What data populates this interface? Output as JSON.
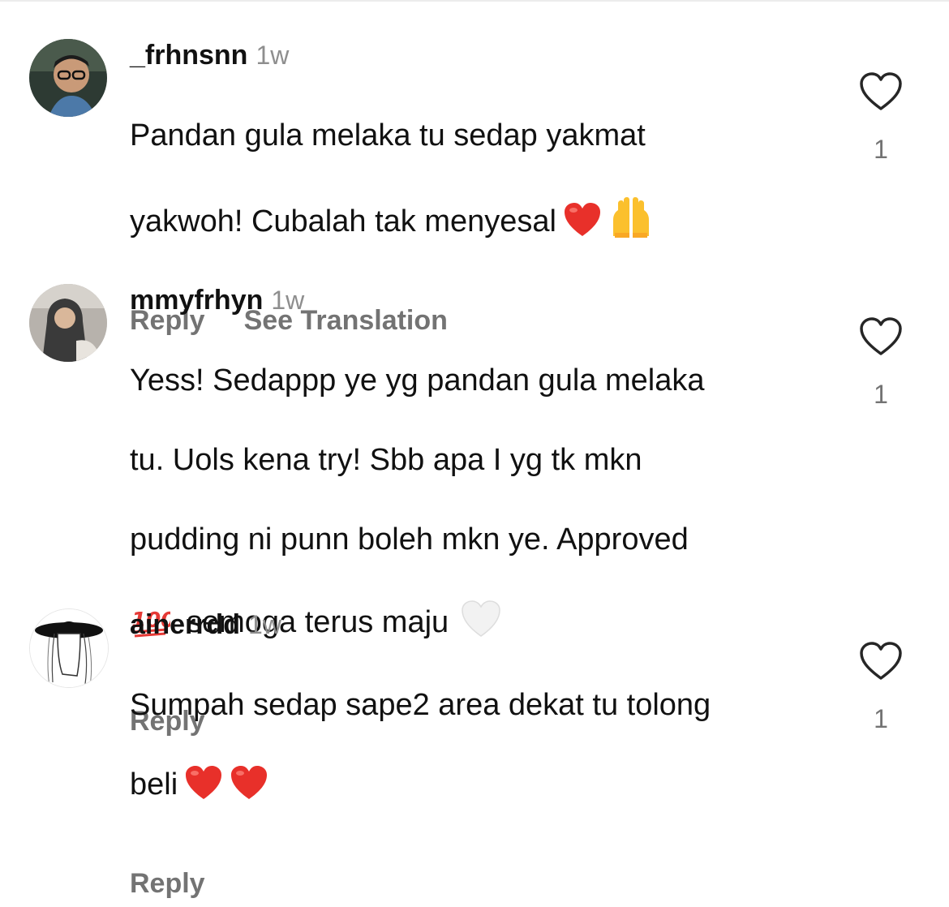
{
  "comments": [
    {
      "username": "_frhnsnn",
      "time": "1w",
      "lines": [
        "Pandan gula melaka tu sedap yakmat",
        "yakwoh! Cubalah tak menyesal"
      ],
      "emojis_line2": [
        "red-heart",
        "raising-hands"
      ],
      "actions": [
        "Reply",
        "See Translation"
      ],
      "likes": "1"
    },
    {
      "username": "mmyfrhyn",
      "time": "1w",
      "lines": [
        "Yess! Sedappp ye yg pandan gula melaka",
        "tu. Uols kena try! Sbb apa I yg tk mkn",
        "pudding ni punn boleh mkn ye. Approved",
        "semoga terus maju"
      ],
      "emojis_line4": [
        "hundred-points",
        "white-heart"
      ],
      "actions": [
        "Reply"
      ],
      "likes": "1"
    },
    {
      "username": "ainerrdd",
      "time": "1w",
      "lines": [
        "Sumpah sedap sape2 area dekat tu tolong",
        "beli"
      ],
      "emojis_line2": [
        "red-heart",
        "red-heart"
      ],
      "actions": [
        "Reply"
      ],
      "likes": "1"
    }
  ],
  "colors": {
    "text": "#111111",
    "muted": "#737373",
    "time": "#8e8e8e",
    "heart_red": "#e8302a"
  }
}
